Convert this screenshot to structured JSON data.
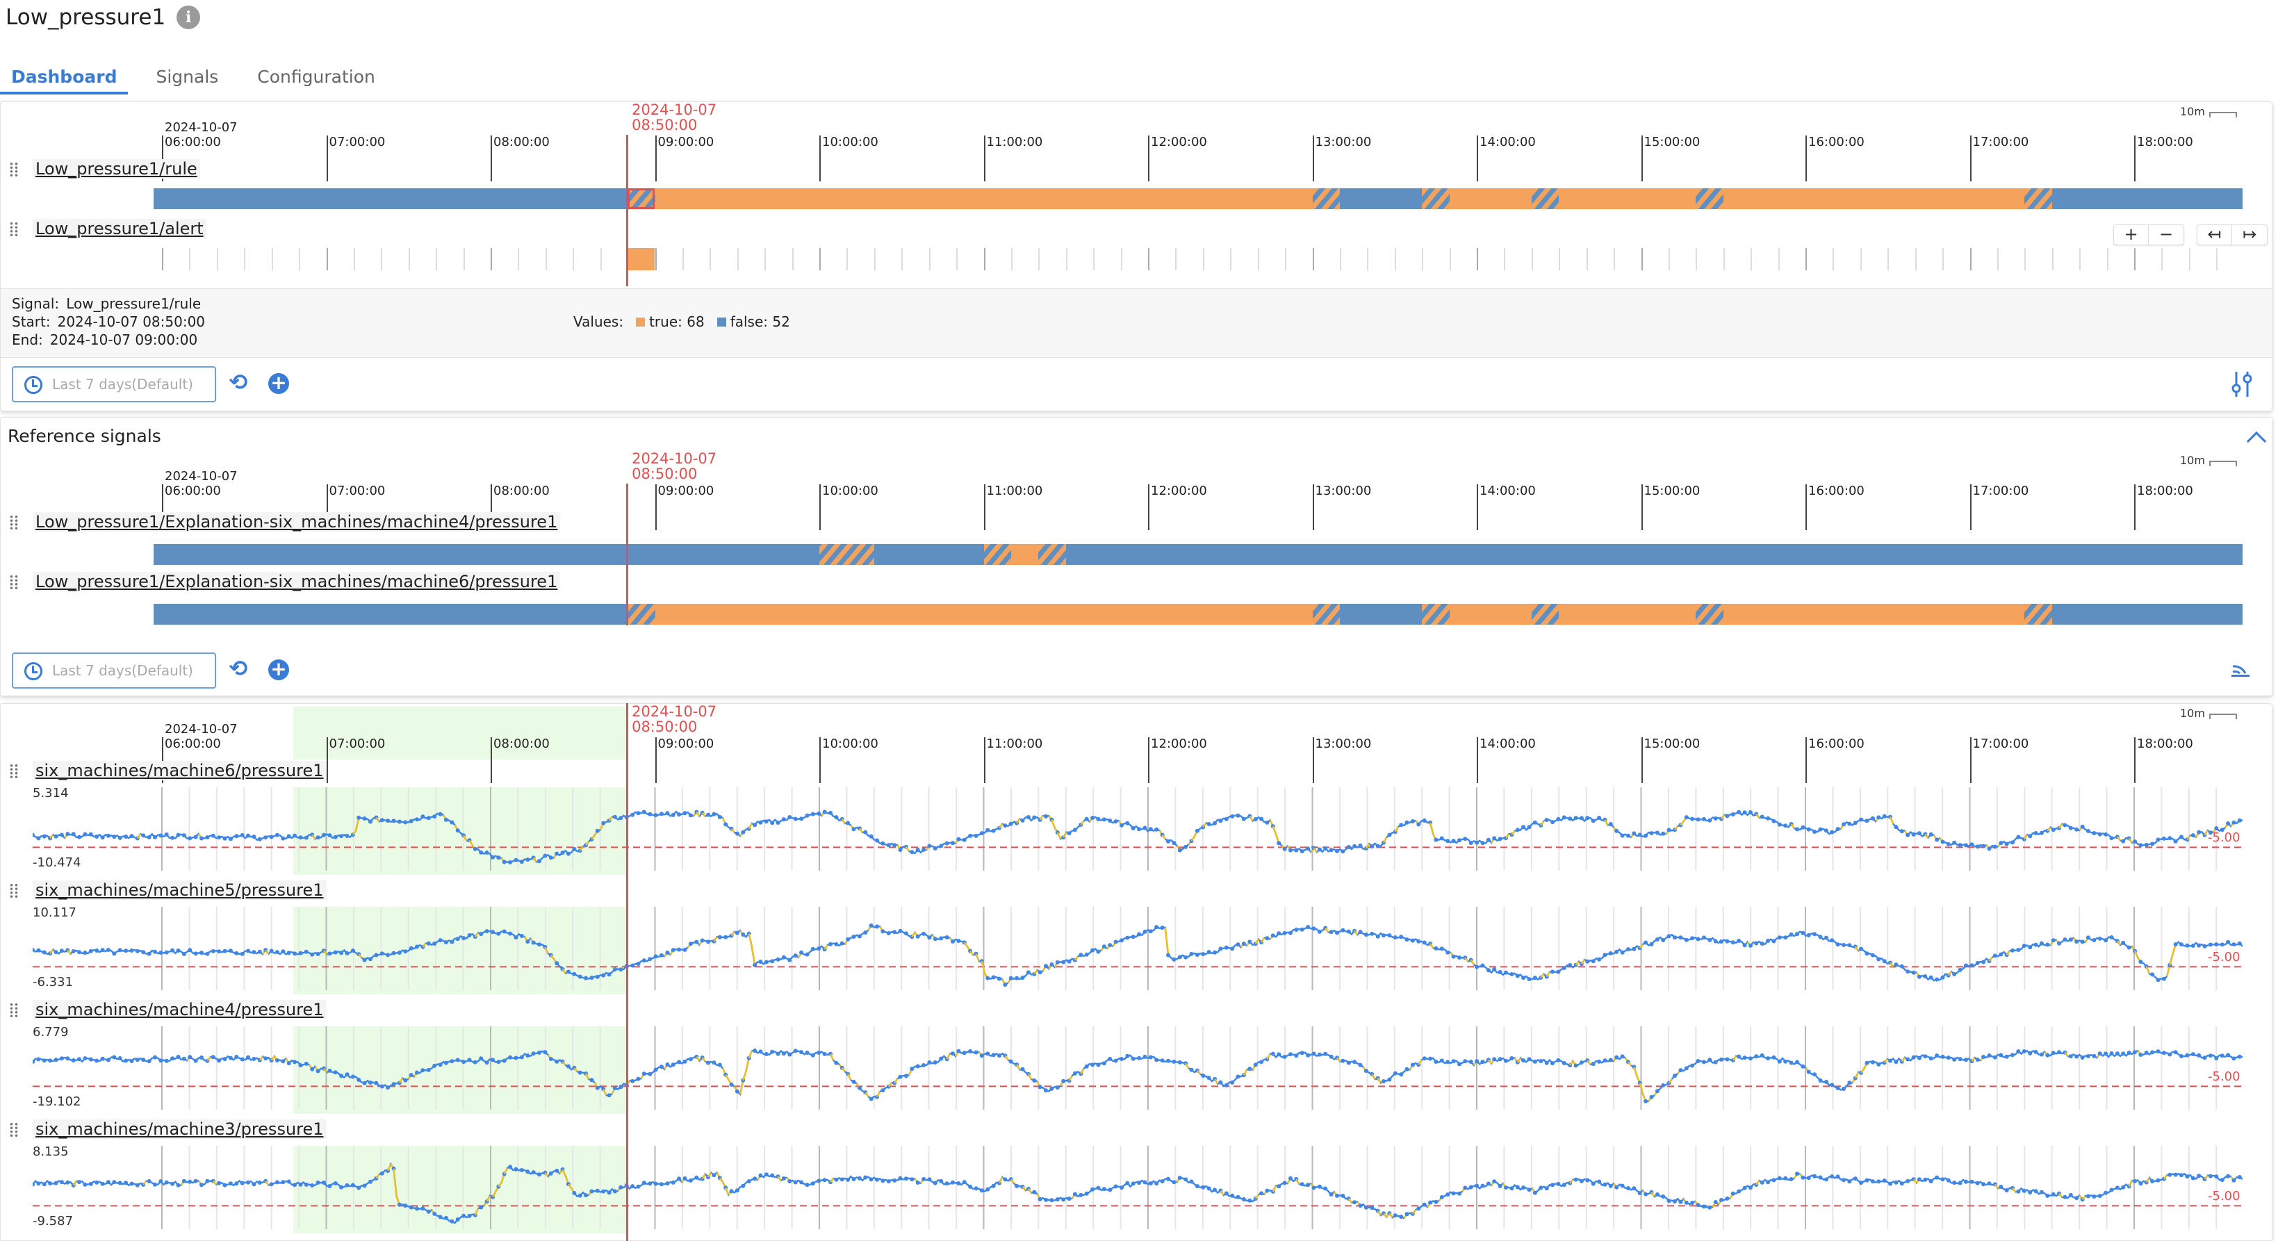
{
  "header": {
    "title": "Low_pressure1"
  },
  "tabs": [
    {
      "label": "Dashboard",
      "active": true
    },
    {
      "label": "Signals",
      "active": false
    },
    {
      "label": "Configuration",
      "active": false
    }
  ],
  "timeline": {
    "first_date": "2024-10-07",
    "hours": [
      "06:00:00",
      "07:00:00",
      "08:00:00",
      "09:00:00",
      "10:00:00",
      "11:00:00",
      "12:00:00",
      "13:00:00",
      "14:00:00",
      "15:00:00",
      "16:00:00",
      "17:00:00",
      "18:00:00"
    ],
    "cursor_date": "2024-10-07",
    "cursor_time": "08:50:00",
    "scale": "10m"
  },
  "rule_panel": {
    "signals": [
      {
        "name": "Low_pressure1/rule",
        "segments": [
          {
            "start": "05:57",
            "end": "08:50",
            "state": "false"
          },
          {
            "start": "08:50",
            "end": "09:00",
            "state": "mixed"
          },
          {
            "start": "09:00",
            "end": "13:00",
            "state": "true"
          },
          {
            "start": "13:00",
            "end": "13:10",
            "state": "mixed"
          },
          {
            "start": "13:10",
            "end": "13:40",
            "state": "false"
          },
          {
            "start": "13:40",
            "end": "13:50",
            "state": "mixed"
          },
          {
            "start": "13:50",
            "end": "14:20",
            "state": "true"
          },
          {
            "start": "14:20",
            "end": "14:30",
            "state": "mixed"
          },
          {
            "start": "14:30",
            "end": "15:20",
            "state": "true"
          },
          {
            "start": "15:20",
            "end": "15:30",
            "state": "mixed"
          },
          {
            "start": "15:30",
            "end": "17:20",
            "state": "true"
          },
          {
            "start": "17:20",
            "end": "17:30",
            "state": "mixed"
          },
          {
            "start": "17:30",
            "end": "18:40",
            "state": "false"
          }
        ]
      },
      {
        "name": "Low_pressure1/alert",
        "events": [
          {
            "start": "08:50",
            "end": "09:00"
          }
        ]
      }
    ],
    "selection": {
      "signal_label": "Signal:",
      "signal": "Low_pressure1/rule",
      "start_label": "Start:",
      "start": "2024-10-07 08:50:00",
      "end_label": "End:",
      "end": "2024-10-07 09:00:00",
      "values_label": "Values:",
      "true_label": "true: 68",
      "false_label": "false: 52"
    },
    "range_button": "Last 7 days(Default)",
    "zoom_buttons": [
      "+",
      "−",
      "↤",
      "↦"
    ]
  },
  "reference_panel": {
    "title": "Reference signals",
    "signals": [
      {
        "name": "Low_pressure1/Explanation-six_machines/machine4/pressure1",
        "segments": [
          {
            "start": "05:57",
            "end": "10:00",
            "state": "false"
          },
          {
            "start": "10:00",
            "end": "10:20",
            "state": "mixed"
          },
          {
            "start": "10:20",
            "end": "11:00",
            "state": "false"
          },
          {
            "start": "11:00",
            "end": "11:10",
            "state": "mixed"
          },
          {
            "start": "11:10",
            "end": "11:20",
            "state": "true"
          },
          {
            "start": "11:20",
            "end": "11:30",
            "state": "mixed"
          },
          {
            "start": "11:30",
            "end": "18:40",
            "state": "false"
          }
        ]
      },
      {
        "name": "Low_pressure1/Explanation-six_machines/machine6/pressure1",
        "segments": [
          {
            "start": "05:57",
            "end": "08:50",
            "state": "false"
          },
          {
            "start": "08:50",
            "end": "09:00",
            "state": "mixed"
          },
          {
            "start": "09:00",
            "end": "13:00",
            "state": "true"
          },
          {
            "start": "13:00",
            "end": "13:10",
            "state": "mixed"
          },
          {
            "start": "13:10",
            "end": "13:40",
            "state": "false"
          },
          {
            "start": "13:40",
            "end": "13:50",
            "state": "mixed"
          },
          {
            "start": "13:50",
            "end": "14:20",
            "state": "true"
          },
          {
            "start": "14:20",
            "end": "14:30",
            "state": "mixed"
          },
          {
            "start": "14:30",
            "end": "15:20",
            "state": "true"
          },
          {
            "start": "15:20",
            "end": "15:30",
            "state": "mixed"
          },
          {
            "start": "15:30",
            "end": "17:20",
            "state": "true"
          },
          {
            "start": "17:20",
            "end": "17:30",
            "state": "mixed"
          },
          {
            "start": "17:30",
            "end": "18:40",
            "state": "false"
          }
        ]
      }
    ],
    "range_button": "Last 7 days(Default)"
  },
  "signals_panel": {
    "highlight": {
      "start": "06:48",
      "end": "08:50"
    },
    "signals": [
      {
        "name": "six_machines/machine6/pressure1",
        "ymax": "5.314",
        "ymin": "-10.474",
        "threshold": "-5.00",
        "seed": 6,
        "knots": [
          [
            0,
            0.4
          ],
          [
            0.08,
            0.4
          ],
          [
            0.1,
            0.38
          ],
          [
            0.146,
            0.4
          ],
          [
            0.147,
            0.62
          ],
          [
            0.17,
            0.6
          ],
          [
            0.185,
            0.7
          ],
          [
            0.2,
            0.25
          ],
          [
            0.215,
            0.05
          ],
          [
            0.23,
            0.1
          ],
          [
            0.25,
            0.25
          ],
          [
            0.26,
            0.62
          ],
          [
            0.275,
            0.7
          ],
          [
            0.31,
            0.68
          ],
          [
            0.32,
            0.38
          ],
          [
            0.325,
            0.55
          ],
          [
            0.36,
            0.7
          ],
          [
            0.385,
            0.3
          ],
          [
            0.4,
            0.2
          ],
          [
            0.42,
            0.35
          ],
          [
            0.435,
            0.5
          ],
          [
            0.45,
            0.62
          ],
          [
            0.46,
            0.65
          ],
          [
            0.465,
            0.38
          ],
          [
            0.48,
            0.65
          ],
          [
            0.51,
            0.45
          ],
          [
            0.52,
            0.2
          ],
          [
            0.53,
            0.55
          ],
          [
            0.545,
            0.65
          ],
          [
            0.56,
            0.6
          ],
          [
            0.565,
            0.25
          ],
          [
            0.59,
            0.2
          ],
          [
            0.61,
            0.3
          ],
          [
            0.62,
            0.55
          ],
          [
            0.633,
            0.6
          ],
          [
            0.634,
            0.35
          ],
          [
            0.66,
            0.33
          ],
          [
            0.68,
            0.55
          ],
          [
            0.69,
            0.62
          ],
          [
            0.71,
            0.62
          ],
          [
            0.72,
            0.4
          ],
          [
            0.74,
            0.45
          ],
          [
            0.75,
            0.65
          ],
          [
            0.76,
            0.62
          ],
          [
            0.775,
            0.7
          ],
          [
            0.8,
            0.5
          ],
          [
            0.815,
            0.45
          ],
          [
            0.82,
            0.55
          ],
          [
            0.84,
            0.65
          ],
          [
            0.845,
            0.45
          ],
          [
            0.86,
            0.4
          ],
          [
            0.87,
            0.28
          ],
          [
            0.885,
            0.25
          ],
          [
            0.905,
            0.42
          ],
          [
            0.92,
            0.55
          ],
          [
            0.94,
            0.4
          ],
          [
            0.955,
            0.3
          ],
          [
            0.975,
            0.38
          ],
          [
            0.99,
            0.5
          ],
          [
            1,
            0.62
          ]
        ]
      },
      {
        "name": "six_machines/machine5/pressure1",
        "ymax": "10.117",
        "ymin": "-6.331",
        "threshold": "-5.00",
        "seed": 5,
        "knots": [
          [
            0,
            0.45
          ],
          [
            0.14,
            0.44
          ],
          [
            0.146,
            0.45
          ],
          [
            0.15,
            0.35
          ],
          [
            0.18,
            0.55
          ],
          [
            0.21,
            0.72
          ],
          [
            0.22,
            0.65
          ],
          [
            0.23,
            0.55
          ],
          [
            0.24,
            0.2
          ],
          [
            0.25,
            0.08
          ],
          [
            0.28,
            0.35
          ],
          [
            0.3,
            0.55
          ],
          [
            0.32,
            0.7
          ],
          [
            0.325,
            0.65
          ],
          [
            0.326,
            0.3
          ],
          [
            0.34,
            0.35
          ],
          [
            0.37,
            0.6
          ],
          [
            0.38,
            0.78
          ],
          [
            0.39,
            0.7
          ],
          [
            0.42,
            0.6
          ],
          [
            0.43,
            0.3
          ],
          [
            0.43,
            0.15
          ],
          [
            0.44,
            0.05
          ],
          [
            0.46,
            0.25
          ],
          [
            0.49,
            0.55
          ],
          [
            0.51,
            0.78
          ],
          [
            0.513,
            0.75
          ],
          [
            0.514,
            0.35
          ],
          [
            0.55,
            0.55
          ],
          [
            0.575,
            0.75
          ],
          [
            0.6,
            0.7
          ],
          [
            0.62,
            0.65
          ],
          [
            0.64,
            0.45
          ],
          [
            0.66,
            0.2
          ],
          [
            0.68,
            0.1
          ],
          [
            0.7,
            0.3
          ],
          [
            0.73,
            0.55
          ],
          [
            0.74,
            0.65
          ],
          [
            0.76,
            0.6
          ],
          [
            0.78,
            0.55
          ],
          [
            0.8,
            0.7
          ],
          [
            0.82,
            0.55
          ],
          [
            0.84,
            0.3
          ],
          [
            0.86,
            0.08
          ],
          [
            0.88,
            0.3
          ],
          [
            0.9,
            0.5
          ],
          [
            0.92,
            0.6
          ],
          [
            0.94,
            0.62
          ],
          [
            0.95,
            0.5
          ],
          [
            0.96,
            0.1
          ],
          [
            0.965,
            0.08
          ],
          [
            0.97,
            0.55
          ],
          [
            1,
            0.55
          ]
        ]
      },
      {
        "name": "six_machines/machine4/pressure1",
        "ymax": "6.779",
        "ymin": "-19.102",
        "threshold": "-5.00",
        "seed": 4,
        "knots": [
          [
            0,
            0.6
          ],
          [
            0.11,
            0.62
          ],
          [
            0.12,
            0.55
          ],
          [
            0.16,
            0.25
          ],
          [
            0.19,
            0.6
          ],
          [
            0.21,
            0.58
          ],
          [
            0.23,
            0.7
          ],
          [
            0.24,
            0.55
          ],
          [
            0.25,
            0.4
          ],
          [
            0.26,
            0.15
          ],
          [
            0.28,
            0.45
          ],
          [
            0.3,
            0.62
          ],
          [
            0.31,
            0.55
          ],
          [
            0.315,
            0.35
          ],
          [
            0.32,
            0.15
          ],
          [
            0.325,
            0.7
          ],
          [
            0.36,
            0.68
          ],
          [
            0.37,
            0.35
          ],
          [
            0.38,
            0.1
          ],
          [
            0.4,
            0.5
          ],
          [
            0.42,
            0.7
          ],
          [
            0.44,
            0.65
          ],
          [
            0.45,
            0.4
          ],
          [
            0.46,
            0.18
          ],
          [
            0.48,
            0.55
          ],
          [
            0.5,
            0.65
          ],
          [
            0.52,
            0.55
          ],
          [
            0.54,
            0.25
          ],
          [
            0.56,
            0.65
          ],
          [
            0.58,
            0.68
          ],
          [
            0.6,
            0.55
          ],
          [
            0.61,
            0.3
          ],
          [
            0.63,
            0.6
          ],
          [
            0.65,
            0.55
          ],
          [
            0.67,
            0.6
          ],
          [
            0.7,
            0.55
          ],
          [
            0.72,
            0.62
          ],
          [
            0.725,
            0.5
          ],
          [
            0.73,
            0.05
          ],
          [
            0.75,
            0.55
          ],
          [
            0.78,
            0.65
          ],
          [
            0.8,
            0.55
          ],
          [
            0.81,
            0.3
          ],
          [
            0.82,
            0.2
          ],
          [
            0.83,
            0.55
          ],
          [
            0.86,
            0.65
          ],
          [
            0.88,
            0.6
          ],
          [
            0.9,
            0.7
          ],
          [
            0.93,
            0.65
          ],
          [
            0.96,
            0.7
          ],
          [
            1,
            0.62
          ]
        ]
      },
      {
        "name": "six_machines/machine3/pressure1",
        "ymax": "8.135",
        "ymin": "-9.587",
        "threshold": "-5.00",
        "seed": 3,
        "knots": [
          [
            0,
            0.55
          ],
          [
            0.12,
            0.55
          ],
          [
            0.15,
            0.5
          ],
          [
            0.16,
            0.7
          ],
          [
            0.163,
            0.85
          ],
          [
            0.165,
            0.3
          ],
          [
            0.18,
            0.2
          ],
          [
            0.19,
            0.05
          ],
          [
            0.2,
            0.15
          ],
          [
            0.21,
            0.45
          ],
          [
            0.215,
            0.75
          ],
          [
            0.23,
            0.65
          ],
          [
            0.24,
            0.7
          ],
          [
            0.245,
            0.4
          ],
          [
            0.26,
            0.45
          ],
          [
            0.28,
            0.55
          ],
          [
            0.3,
            0.6
          ],
          [
            0.31,
            0.7
          ],
          [
            0.315,
            0.4
          ],
          [
            0.32,
            0.5
          ],
          [
            0.33,
            0.65
          ],
          [
            0.35,
            0.55
          ],
          [
            0.37,
            0.62
          ],
          [
            0.4,
            0.58
          ],
          [
            0.42,
            0.55
          ],
          [
            0.43,
            0.45
          ],
          [
            0.44,
            0.62
          ],
          [
            0.46,
            0.3
          ],
          [
            0.48,
            0.45
          ],
          [
            0.5,
            0.55
          ],
          [
            0.52,
            0.6
          ],
          [
            0.54,
            0.4
          ],
          [
            0.55,
            0.3
          ],
          [
            0.57,
            0.6
          ],
          [
            0.59,
            0.4
          ],
          [
            0.61,
            0.15
          ],
          [
            0.62,
            0.1
          ],
          [
            0.64,
            0.4
          ],
          [
            0.66,
            0.55
          ],
          [
            0.68,
            0.45
          ],
          [
            0.7,
            0.6
          ],
          [
            0.72,
            0.5
          ],
          [
            0.74,
            0.35
          ],
          [
            0.76,
            0.25
          ],
          [
            0.78,
            0.55
          ],
          [
            0.8,
            0.65
          ],
          [
            0.82,
            0.6
          ],
          [
            0.84,
            0.55
          ],
          [
            0.86,
            0.6
          ],
          [
            0.88,
            0.55
          ],
          [
            0.9,
            0.45
          ],
          [
            0.93,
            0.35
          ],
          [
            0.95,
            0.55
          ],
          [
            0.97,
            0.65
          ],
          [
            1,
            0.6
          ]
        ]
      }
    ]
  },
  "colors": {
    "accent": "#3a7bd5",
    "true_state": "#f5a35c",
    "false_state": "#5f8fc0",
    "cursor": "#e05050",
    "highlight": "#e9fbe5"
  },
  "icons": [
    "info-icon",
    "clock-icon",
    "refresh-icon",
    "plus-icon",
    "filter-settings-icon",
    "chevron-up-icon",
    "rss-icon"
  ]
}
